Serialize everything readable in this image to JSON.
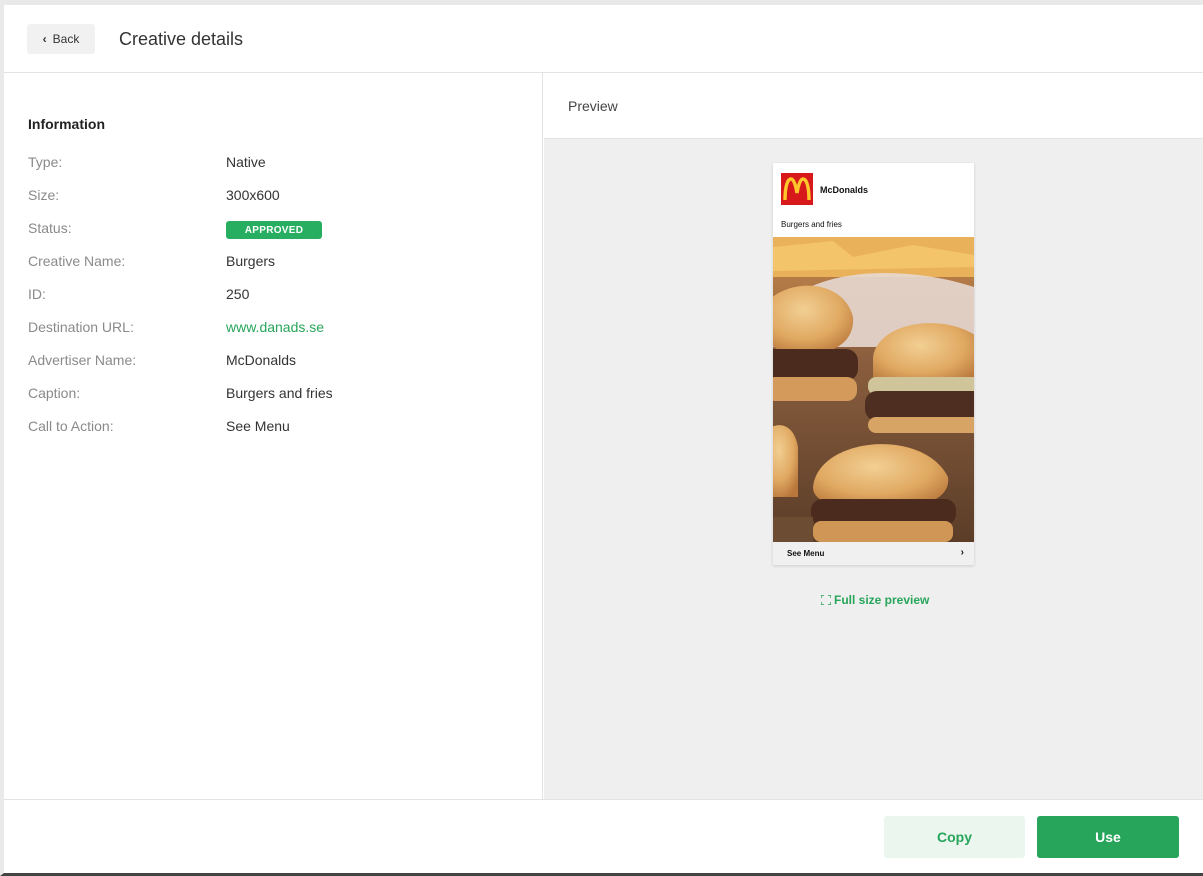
{
  "header": {
    "back_label": "Back",
    "title": "Creative details"
  },
  "information": {
    "title": "Information",
    "rows": [
      {
        "label": "Type:",
        "value": "Native"
      },
      {
        "label": "Size:",
        "value": "300x600"
      },
      {
        "label": "Status:",
        "value": "APPROVED"
      },
      {
        "label": "Creative Name:",
        "value": "Burgers"
      },
      {
        "label": "ID:",
        "value": "250"
      },
      {
        "label": "Destination URL:",
        "value": "www.danads.se"
      },
      {
        "label": "Advertiser Name:",
        "value": "McDonalds"
      },
      {
        "label": "Caption:",
        "value": "Burgers and fries"
      },
      {
        "label": "Call to Action:",
        "value": "See Menu"
      }
    ]
  },
  "preview": {
    "label": "Preview",
    "ad": {
      "advertiser": "McDonalds",
      "caption": "Burgers and fries",
      "cta": "See Menu",
      "logo_icon": "mcdonalds-logo-icon",
      "image_icon": "burgers-photo"
    },
    "full_size_label": "Full size preview",
    "full_size_icon": "expand-icon"
  },
  "footer": {
    "copy_label": "Copy",
    "use_label": "Use"
  },
  "colors": {
    "accent": "#27a55a",
    "status_approved": "#27ae60",
    "brand_red": "#d8191c",
    "brand_yellow": "#ffc72c"
  }
}
